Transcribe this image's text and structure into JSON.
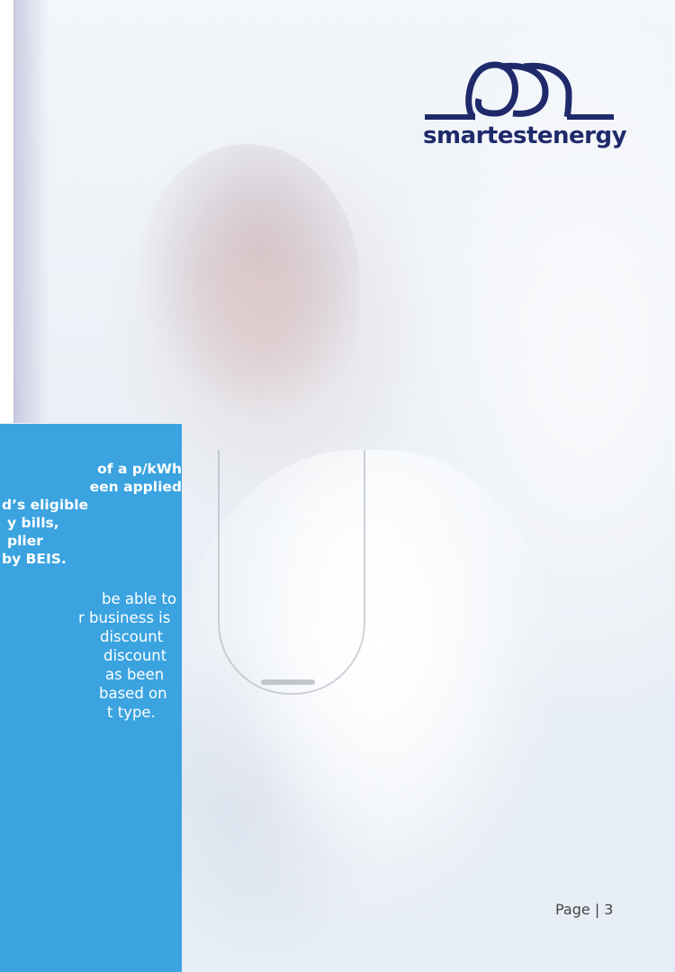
{
  "logo": {
    "wordmark": "smartestenergy",
    "brand_color": "#1f2a6b"
  },
  "panel": {
    "background_color": "#3aa3e0",
    "bold_lines": [
      "of a p/kWh",
      "een applied",
      "d’s eligible",
      "y bills,",
      "plier",
      "by BEIS."
    ],
    "body_lines": [
      "be able to",
      "r business is",
      "discount",
      "discount",
      "as been",
      "based on",
      "t type."
    ]
  },
  "footer": {
    "page_label": "Page | 3"
  }
}
